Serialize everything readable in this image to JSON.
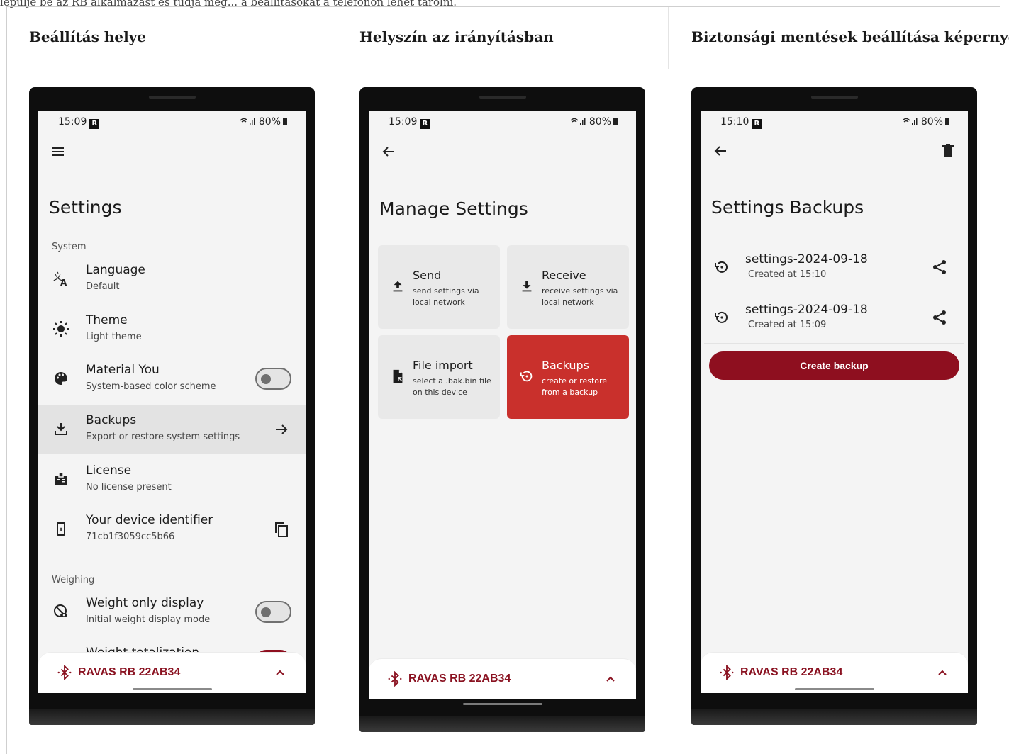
{
  "page": {
    "top_crop_text": "lepülje be az RB alkalmazást és tudja meg... a beállításokat a telefonon lehet tárolni.",
    "columns": [
      "Beállítás helye",
      "Helyszín az irányításban",
      "Biztonsági mentések beállítása képernyő"
    ]
  },
  "colors": {
    "accent": "#8e0f1f",
    "tile_active": "#c9302c",
    "screen_bg": "#f4f4f4"
  },
  "screen1": {
    "status": {
      "time": "15:09",
      "badge": "R",
      "battery": "80%"
    },
    "menu_icon": "hamburger-icon",
    "title": "Settings",
    "section_system": "System",
    "items": [
      {
        "icon": "translate-icon",
        "title": "Language",
        "subtitle": "Default"
      },
      {
        "icon": "brightness-icon",
        "title": "Theme",
        "subtitle": "Light theme"
      },
      {
        "icon": "palette-icon",
        "title": "Material You",
        "subtitle": "System-based color scheme",
        "toggle": "off"
      },
      {
        "icon": "download-icon",
        "title": "Backups",
        "subtitle": "Export or restore system settings",
        "trailing": "arrow-right-icon"
      },
      {
        "icon": "badge-icon",
        "title": "License",
        "subtitle": "No license present"
      },
      {
        "icon": "device-info-icon",
        "title": "Your device identifier",
        "subtitle": "71cb1f3059cc5b66",
        "trailing": "copy-icon"
      }
    ],
    "section_weighing": "Weighing",
    "weighing_items": [
      {
        "icon": "weight-eye-icon",
        "title": "Weight only display",
        "subtitle": "Initial weight display mode",
        "toggle": "off"
      }
    ],
    "partial_item": "Weight totalization",
    "device": "RAVAS RB 22AB34"
  },
  "screen2": {
    "status": {
      "time": "15:09",
      "badge": "R",
      "battery": "80%"
    },
    "title": "Manage Settings",
    "tiles": [
      {
        "icon": "upload-icon",
        "title": "Send",
        "subtitle": "send settings via local network"
      },
      {
        "icon": "download-tray-icon",
        "title": "Receive",
        "subtitle": "receive settings via local network"
      },
      {
        "icon": "file-import-icon",
        "title": "File import",
        "subtitle": "select a .bak.bin file on this device"
      },
      {
        "icon": "restore-icon",
        "title": "Backups",
        "subtitle": "create or restore from a backup",
        "active": true
      }
    ],
    "device": "RAVAS RB 22AB34"
  },
  "screen3": {
    "status": {
      "time": "15:10",
      "badge": "R",
      "battery": "80%"
    },
    "title": "Settings Backups",
    "backups": [
      {
        "name": "settings-2024-09-18",
        "created": "Created at 15:10"
      },
      {
        "name": "settings-2024-09-18",
        "created": "Created at 15:09"
      }
    ],
    "create_label": "Create backup",
    "device": "RAVAS RB 22AB34"
  }
}
